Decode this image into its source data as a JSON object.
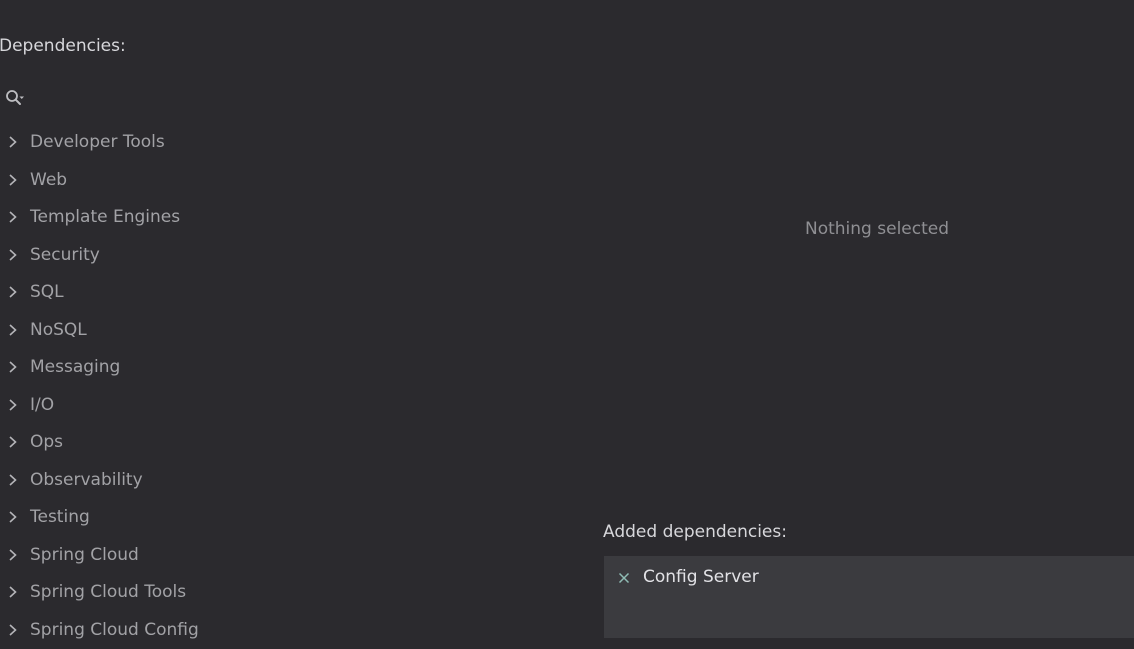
{
  "dependencies": {
    "title": "Dependencies:",
    "search": {
      "value": "",
      "placeholder": ""
    },
    "categories": [
      {
        "label": "Developer Tools"
      },
      {
        "label": "Web"
      },
      {
        "label": "Template Engines"
      },
      {
        "label": "Security"
      },
      {
        "label": "SQL"
      },
      {
        "label": "NoSQL"
      },
      {
        "label": "Messaging"
      },
      {
        "label": "I/O"
      },
      {
        "label": "Ops"
      },
      {
        "label": "Observability"
      },
      {
        "label": "Testing"
      },
      {
        "label": "Spring Cloud"
      },
      {
        "label": "Spring Cloud Tools"
      },
      {
        "label": "Spring Cloud Config"
      }
    ]
  },
  "details": {
    "empty_text": "Nothing selected"
  },
  "added": {
    "title": "Added dependencies:",
    "items": [
      {
        "label": "Config Server"
      }
    ]
  },
  "icons": {
    "search": "search-with-dropdown-icon",
    "expand": "chevron-right-icon",
    "remove": "close-icon"
  },
  "colors": {
    "background": "#2b2a2e",
    "added_panel": "#3b3b3f",
    "text_primary": "#d7d7db",
    "text_secondary": "#a2a2a6"
  }
}
